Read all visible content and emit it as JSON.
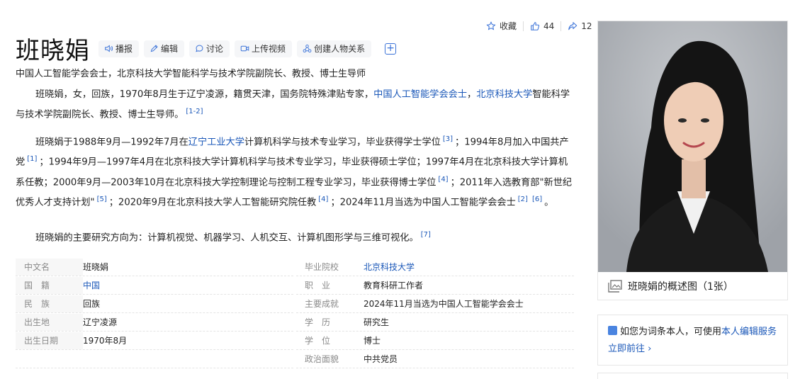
{
  "actions": {
    "collect": "收藏",
    "like_count": "44",
    "share_count": "12"
  },
  "title": "班晓娟",
  "toolbar": {
    "broadcast": "播报",
    "edit": "编辑",
    "discuss": "讨论",
    "upload_video": "上传视频",
    "create_relation": "创建人物关系",
    "add": "+"
  },
  "subtitle": "中国人工智能学会会士，北京科技大学智能科学与技术学院副院长、教授、博士生导师",
  "summary": {
    "t1": "班晓娟，女，回族，1970年8月生于辽宁凌源，籍贯天津，国务院特殊津贴专家，",
    "l1": "中国人工智能学会会士",
    "t2": "，",
    "l2": "北京科技大学",
    "t3": "智能科学与技术学院副院长、教授、博士生导师。",
    "r1": "[1-2]"
  },
  "career": {
    "t1": "班晓娟于1988年9月—1992年7月在",
    "l1": "辽宁工业大学",
    "t2": "计算机科学与技术专业学习，毕业获得学士学位",
    "r1": "[3]",
    "t3": "；1994年8月加入中国共产党",
    "r2": "[1]",
    "t4": "；1994年9月—1997年4月在北京科技大学计算机科学与技术专业学习，毕业获得硕士学位；1997年4月在北京科技大学计算机系任教；2000年9月—2003年10月在北京科技大学控制理论与控制工程专业学习，毕业获得博士学位",
    "r3": "[4]",
    "t5": "；2011年入选教育部\"新世纪优秀人才支持计划\"",
    "r4": "[5]",
    "t6": "；2020年9月在北京科技大学人工智能研究院任教",
    "r5": "[4]",
    "t7": "；2024年11月当选为中国人工智能学会会士",
    "r6": "[2]",
    "r7": "[6]",
    "t8": "。"
  },
  "research": {
    "text": "班晓娟的主要研究方向为：计算机视觉、机器学习、人机交互、计算机图形学与三维可视化。",
    "ref": "[7]"
  },
  "basic_info": {
    "left": [
      {
        "key": "中文名",
        "value": "班晓娟"
      },
      {
        "key": "国　籍",
        "value": "中国"
      },
      {
        "key": "民　族",
        "value": "回族"
      },
      {
        "key": "出生地",
        "value": "辽宁凌源"
      },
      {
        "key": "出生日期",
        "value": "1970年8月"
      }
    ],
    "right": [
      {
        "key": "毕业院校",
        "value": "北京科技大学"
      },
      {
        "key": "职　业",
        "value": "教育科研工作者"
      },
      {
        "key": "主要成就",
        "value": "2024年11月当选为中国人工智能学会会士"
      },
      {
        "key": "学　历",
        "value": "研究生"
      },
      {
        "key": "学　位",
        "value": "博士"
      },
      {
        "key": "政治面貌",
        "value": "中共党员"
      }
    ]
  },
  "photo": {
    "caption": "班晓娟的概述图（1张）"
  },
  "edit_prompt": {
    "text": "如您为词条本人，可使用",
    "link": "本人编辑服务",
    "go": "立即前往 ›"
  }
}
